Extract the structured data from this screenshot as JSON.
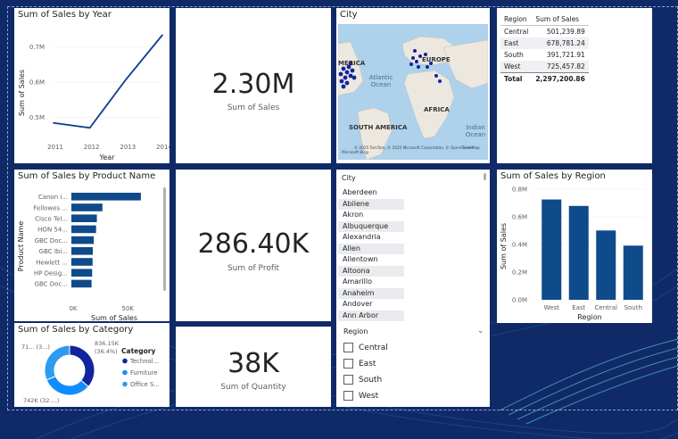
{
  "tiles": {
    "sales_by_year": {
      "title": "Sum of Sales by Year",
      "xlabel": "Year",
      "ylabel": "Sum of Sales"
    },
    "sales_card": {
      "value": "2.30M",
      "label": "Sum of Sales"
    },
    "city_map": {
      "title": "City",
      "labels": {
        "america": "MERICA",
        "europe": "EUROPE",
        "atlantic": "Atlantic",
        "ocean": "Ocean",
        "africa": "AFRICA",
        "south_america": "SOUTH AMERICA",
        "indian": "Indian",
        "indian_ocean": "Ocean"
      },
      "attribution": "© 2025 TomTom, © 2025 Microsoft Corporation, © OpenStreetMap",
      "terms": "Terms",
      "logo": "Microsoft Bing"
    },
    "region_table": {
      "headers": [
        "Region",
        "Sum of Sales"
      ],
      "rows": [
        [
          "Central",
          "501,239.89"
        ],
        [
          "East",
          "678,781.24"
        ],
        [
          "South",
          "391,721.91"
        ],
        [
          "West",
          "725,457.82"
        ]
      ],
      "total": [
        "Total",
        "2,297,200.86"
      ]
    },
    "sales_by_product": {
      "title": "Sum of Sales by Product Name",
      "xlabel": "Sum of Sales",
      "ylabel": "Product Name"
    },
    "profit_card": {
      "value": "286.40K",
      "label": "Sum of Profit"
    },
    "city_slicer": {
      "header": "City",
      "items": [
        "Aberdeen",
        "Abilene",
        "Akron",
        "Albuquerque",
        "Alexandria",
        "Allen",
        "Allentown",
        "Altoona",
        "Amarillo",
        "Anaheim",
        "Andover",
        "Ann Arbor"
      ]
    },
    "region_slicer": {
      "header": "Region",
      "options": [
        "Central",
        "East",
        "South",
        "West"
      ]
    },
    "sales_by_region": {
      "title": "Sum of Sales by Region",
      "xlabel": "Region",
      "ylabel": "Sum of Sales"
    },
    "sales_by_category": {
      "title": "Sum of Sales by Category",
      "legend_title": "Category",
      "legend": [
        "Technol...",
        "Furniture",
        "Office S..."
      ],
      "labels": {
        "top_left": "71... (3...)",
        "top_right": "836.15K",
        "top_right_pct": "(36.4%)",
        "bottom": "742K (32....)"
      }
    },
    "quantity_card": {
      "value": "38K",
      "label": "Sum of Quantity"
    }
  },
  "colors": {
    "accent": "#118dff",
    "navy": "#12239e",
    "bar": "#0f4a8a",
    "dark": "#0b3d91",
    "light": "#2d9cf0",
    "bg": "#0f2a66"
  },
  "chart_data": [
    {
      "type": "line",
      "title": "Sum of Sales by Year",
      "x": [
        "2011",
        "2012",
        "2013",
        "2014"
      ],
      "values": [
        484000,
        470000,
        608000,
        734000
      ],
      "xlabel": "Year",
      "ylabel": "Sum of Sales",
      "yticks": [
        "0.5M",
        "0.6M",
        "0.7M"
      ],
      "ylim": [
        430000,
        760000
      ]
    },
    {
      "type": "bar",
      "orientation": "horizontal",
      "title": "Sum of Sales by Product Name",
      "categories": [
        "Canon i...",
        "Fellowes ...",
        "Cisco Tel...",
        "HON 54...",
        "GBC Doc...",
        "GBC Ibi...",
        "Hewlett ...",
        "HP Desig...",
        "GBC Doc..."
      ],
      "values": [
        61600,
        27500,
        22600,
        21900,
        19800,
        19000,
        18800,
        18400,
        17900
      ],
      "xticks": [
        "0K",
        "50K"
      ],
      "xlim": [
        0,
        68000
      ],
      "xlabel": "Sum of Sales",
      "ylabel": "Product Name"
    },
    {
      "type": "bar",
      "title": "Sum of Sales by Region",
      "categories": [
        "West",
        "East",
        "Central",
        "South"
      ],
      "values": [
        725457.82,
        678781.24,
        501239.89,
        391721.91
      ],
      "yticks": [
        "0.0M",
        "0.2M",
        "0.4M",
        "0.6M",
        "0.8M"
      ],
      "ylim": [
        0,
        800000
      ],
      "xlabel": "Region",
      "ylabel": "Sum of Sales"
    },
    {
      "type": "pie",
      "title": "Sum of Sales by Category",
      "categories": [
        "Technol...",
        "Furniture",
        "Office S..."
      ],
      "values": [
        836.15,
        742,
        719
      ]
    }
  ]
}
